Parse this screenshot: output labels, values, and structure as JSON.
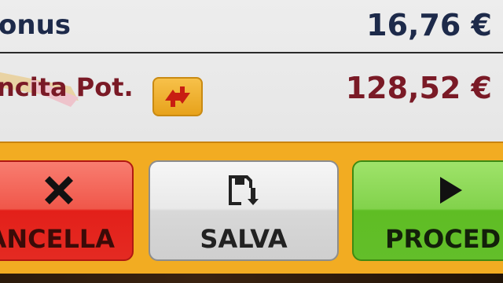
{
  "summary": {
    "bonus": {
      "label": "onus",
      "value": "16,76 €"
    },
    "winnings": {
      "label": "ncita Pot.",
      "value": "128,52 €"
    }
  },
  "icons": {
    "swap": "swap-arrows-icon",
    "cancel": "x-icon",
    "save": "save-icon",
    "proceed": "play-icon"
  },
  "actions": {
    "cancel_label": "ANCELLA",
    "save_label": "SALVA",
    "proceed_label": "PROCED"
  },
  "colors": {
    "bar": "#f2ac22",
    "cancel": "#e3201a",
    "proceed": "#5fbd24",
    "value_primary": "#1d2a4a",
    "value_secondary": "#7a1a26"
  }
}
